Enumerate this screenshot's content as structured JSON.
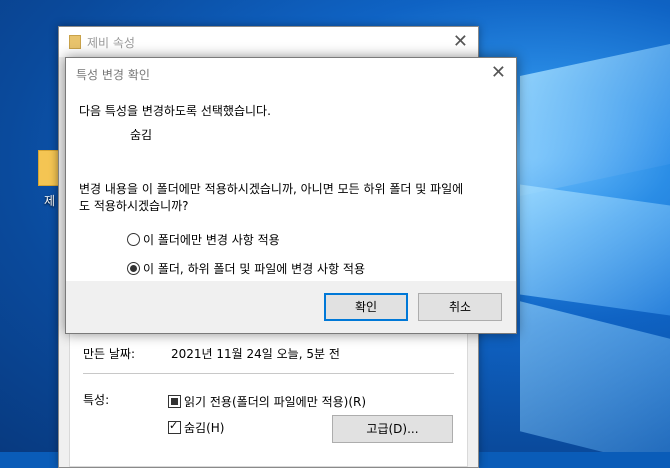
{
  "desktop": {
    "icon_label": "제"
  },
  "properties_window": {
    "title": "제비 속성",
    "created_label": "만든 날짜:",
    "created_value": "2021년 11월 24일 오늘, 5분 전",
    "attributes_label": "특성:",
    "readonly_label": "읽기 전용(폴더의 파일에만 적용)(R)",
    "readonly_state": "indeterminate",
    "hidden_label": "숨김(H)",
    "hidden_state": "checked",
    "advanced_button": "고급(D)..."
  },
  "dialog": {
    "title": "특성 변경 확인",
    "intro": "다음 특성을 변경하도록 선택했습니다.",
    "attribute": "숨김",
    "question_line1": "변경 내용을 이 폴더에만 적용하시겠습니까, 아니면 모든 하위 폴더 및 파일에",
    "question_line2": "도 적용하시겠습니까?",
    "options": [
      {
        "label": "이 폴더에만 변경 사항 적용",
        "selected": false
      },
      {
        "label": "이 폴더, 하위 폴더 및 파일에 변경 사항 적용",
        "selected": true
      }
    ],
    "ok_button": "확인",
    "cancel_button": "취소"
  }
}
